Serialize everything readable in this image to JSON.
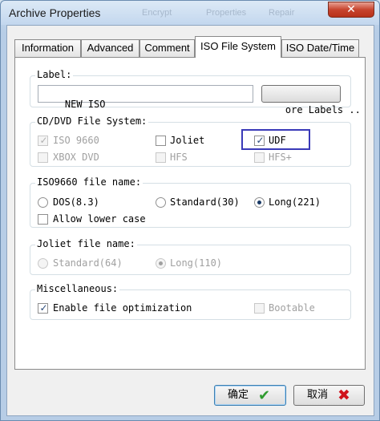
{
  "window": {
    "title": "Archive Properties",
    "ghost_titles": [
      "Encrypt",
      "Properties",
      "Repair"
    ],
    "close_glyph": "✕"
  },
  "tabs": [
    {
      "label": "Information",
      "active": false
    },
    {
      "label": "Advanced",
      "active": false
    },
    {
      "label": "Comment",
      "active": false
    },
    {
      "label": "ISO File System",
      "active": true
    },
    {
      "label": "ISO Date/Time",
      "active": false
    }
  ],
  "label_group": {
    "title": "Label:",
    "value": "NEW ISO",
    "more_button": "ore Labels .."
  },
  "cd_group": {
    "title": "CD/DVD File System:",
    "options": [
      {
        "label": "ISO 9660",
        "checked": true,
        "enabled": false
      },
      {
        "label": "Joliet",
        "checked": false,
        "enabled": true
      },
      {
        "label": "UDF",
        "checked": true,
        "enabled": true
      },
      {
        "label": "XBOX DVD",
        "checked": false,
        "enabled": false
      },
      {
        "label": "HFS",
        "checked": false,
        "enabled": false
      },
      {
        "label": "HFS+",
        "checked": false,
        "enabled": false
      }
    ]
  },
  "iso_group": {
    "title": "ISO9660 file name:",
    "radios": [
      {
        "label": "DOS(8.3)",
        "selected": false
      },
      {
        "label": "Standard(30)",
        "selected": false
      },
      {
        "label": "Long(221)",
        "selected": true
      }
    ],
    "lower_case": {
      "label": "Allow lower case",
      "checked": false
    }
  },
  "joliet_group": {
    "title": "Joliet file name:",
    "radios": [
      {
        "label": "Standard(64)",
        "selected": false
      },
      {
        "label": "Long(110)",
        "selected": true
      }
    ]
  },
  "misc_group": {
    "title": "Miscellaneous:",
    "optimize": {
      "label": "Enable file optimization",
      "checked": true
    },
    "bootable": {
      "label": "Bootable",
      "checked": false
    }
  },
  "buttons": {
    "ok_label": "确定",
    "cancel_label": "取消",
    "check_glyph": "✔",
    "x_glyph": "✖"
  },
  "icons": {
    "checkmark_glyph": "✓"
  },
  "colors": {
    "highlight": "#3a3ab8",
    "ok_icon": "#2f9b2f",
    "cancel_icon": "#d0121b"
  }
}
